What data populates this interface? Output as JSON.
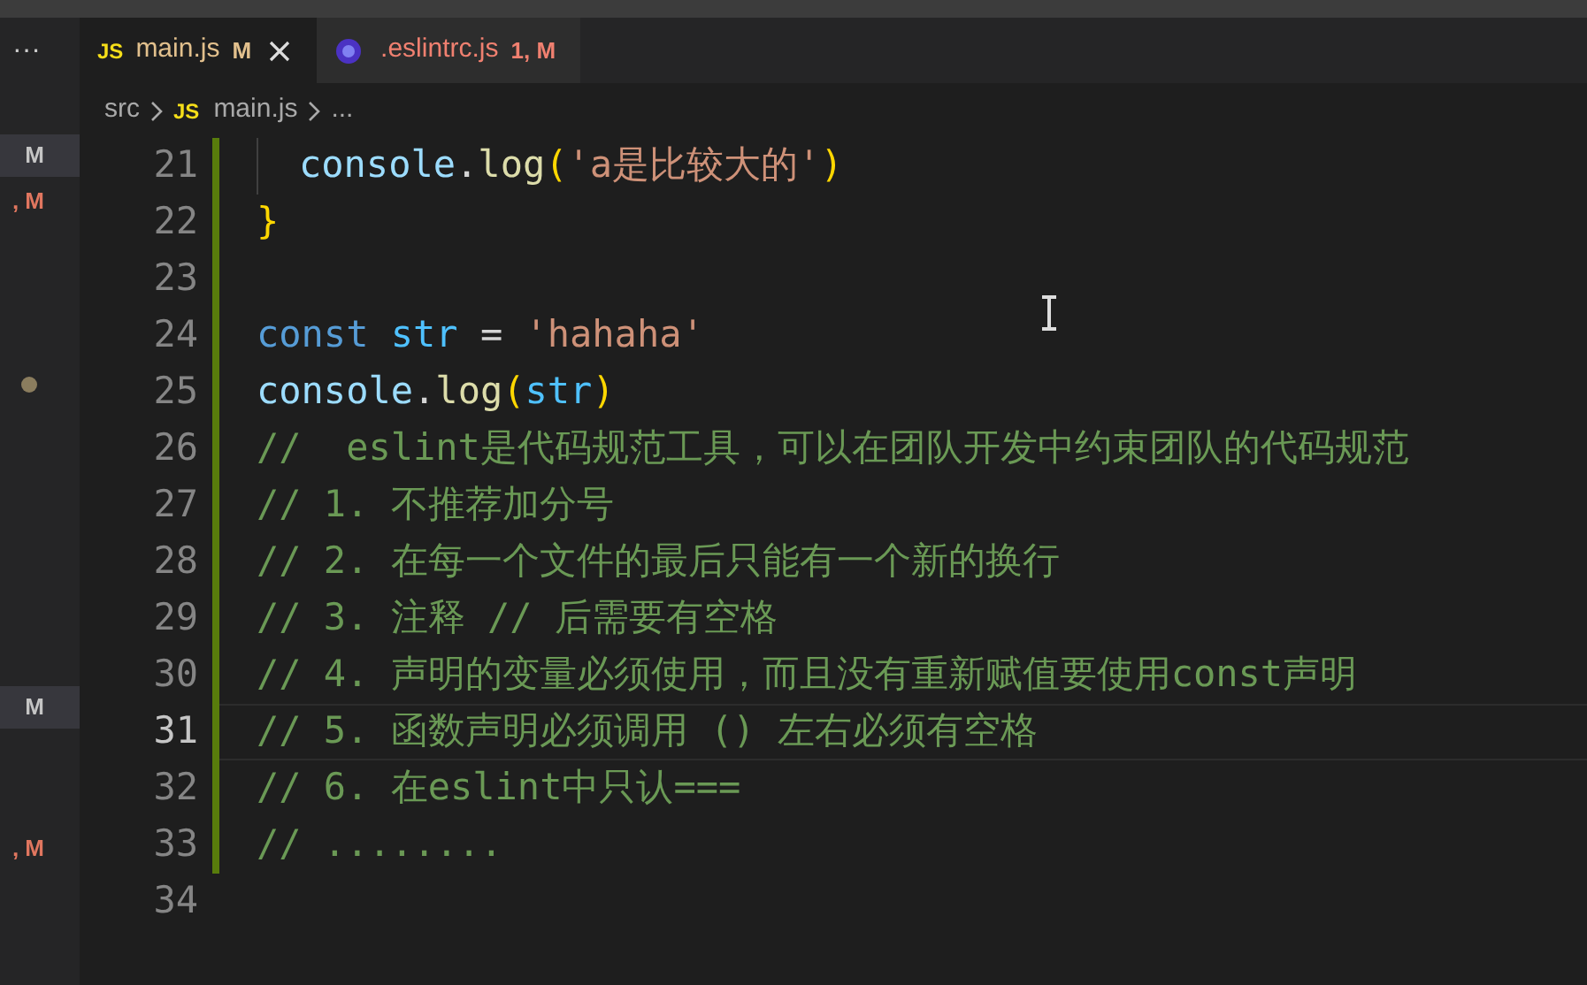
{
  "activity_sidebar": {
    "more": "···",
    "items": [
      {
        "kind": "badge",
        "text": "M",
        "selected": true
      },
      {
        "kind": "badge",
        "text": ", M",
        "selected": false
      },
      {
        "kind": "dot"
      },
      {
        "kind": "badge",
        "text": "M",
        "selected": true
      },
      {
        "kind": "badge",
        "text": ", M",
        "selected": false
      }
    ]
  },
  "tabs": [
    {
      "kind": "js",
      "icon_text": "JS",
      "label": "main.js",
      "badge": "M",
      "color": "#e2c08d",
      "selected": true
    },
    {
      "kind": "eslint",
      "label": ".eslintrc.js",
      "badge": "1, M",
      "color": "#f08070",
      "selected": false
    }
  ],
  "breadcrumb": [
    {
      "kind": "folder",
      "label": "src"
    },
    {
      "kind": "js",
      "icon_text": "JS",
      "label": "main.js"
    },
    {
      "kind": "more",
      "label": "..."
    }
  ],
  "editor": {
    "lines": [
      {
        "number": "21",
        "current": false,
        "indented": true,
        "tokens": [
          {
            "kind": "variable",
            "text": "console"
          },
          {
            "kind": "plain",
            "text": "."
          },
          {
            "kind": "function",
            "text": "log"
          },
          {
            "kind": "bracket",
            "text": "("
          },
          {
            "kind": "string",
            "text": "'a是比较大的'"
          },
          {
            "kind": "bracket",
            "text": ")"
          }
        ]
      },
      {
        "number": "22",
        "current": false,
        "indented": false,
        "tokens": [
          {
            "kind": "bracket",
            "text": "}"
          }
        ]
      },
      {
        "number": "23",
        "current": false,
        "indented": false
      },
      {
        "number": "24",
        "current": false,
        "indented": false,
        "tokens": [
          {
            "kind": "keyword",
            "text": "const"
          },
          {
            "kind": "constant",
            "text": " str"
          },
          {
            "kind": "plain",
            "text": " = "
          },
          {
            "kind": "string",
            "text": "'hahaha'"
          }
        ]
      },
      {
        "number": "25",
        "current": false,
        "indented": false,
        "tokens": [
          {
            "kind": "variable",
            "text": "console"
          },
          {
            "kind": "plain",
            "text": "."
          },
          {
            "kind": "function",
            "text": "log"
          },
          {
            "kind": "bracket",
            "text": "("
          },
          {
            "kind": "constant",
            "text": "str"
          },
          {
            "kind": "bracket",
            "text": ")"
          }
        ]
      },
      {
        "number": "26",
        "current": false,
        "indented": false,
        "tokens": [
          {
            "kind": "comment",
            "text": "//  eslint是代码规范工具，可以在团队开发中约束团队的代码规范"
          }
        ]
      },
      {
        "number": "27",
        "current": false,
        "indented": false,
        "tokens": [
          {
            "kind": "comment",
            "text": "// 1. 不推荐加分号"
          }
        ]
      },
      {
        "number": "28",
        "current": false,
        "indented": false,
        "tokens": [
          {
            "kind": "comment",
            "text": "// 2. 在每一个文件的最后只能有一个新的换行"
          }
        ]
      },
      {
        "number": "29",
        "current": false,
        "indented": false,
        "tokens": [
          {
            "kind": "comment",
            "text": "// 3. 注释 // 后需要有空格"
          }
        ]
      },
      {
        "number": "30",
        "current": false,
        "indented": false,
        "tokens": [
          {
            "kind": "comment",
            "text": "// 4. 声明的变量必须使用，而且没有重新赋值要使用const声明"
          }
        ]
      },
      {
        "number": "31",
        "current": true,
        "indented": false,
        "tokens": [
          {
            "kind": "comment",
            "text": "// 5. 函数声明必须调用 () 左右必须有空格"
          }
        ]
      },
      {
        "number": "32",
        "current": false,
        "indented": false,
        "tokens": [
          {
            "kind": "comment",
            "text": "// 6. 在eslint中只认==="
          }
        ]
      },
      {
        "number": "33",
        "current": false,
        "indented": false,
        "tokens": [
          {
            "kind": "comment",
            "text": "// ........"
          }
        ]
      },
      {
        "number": "34",
        "current": false,
        "indented": false
      }
    ]
  }
}
